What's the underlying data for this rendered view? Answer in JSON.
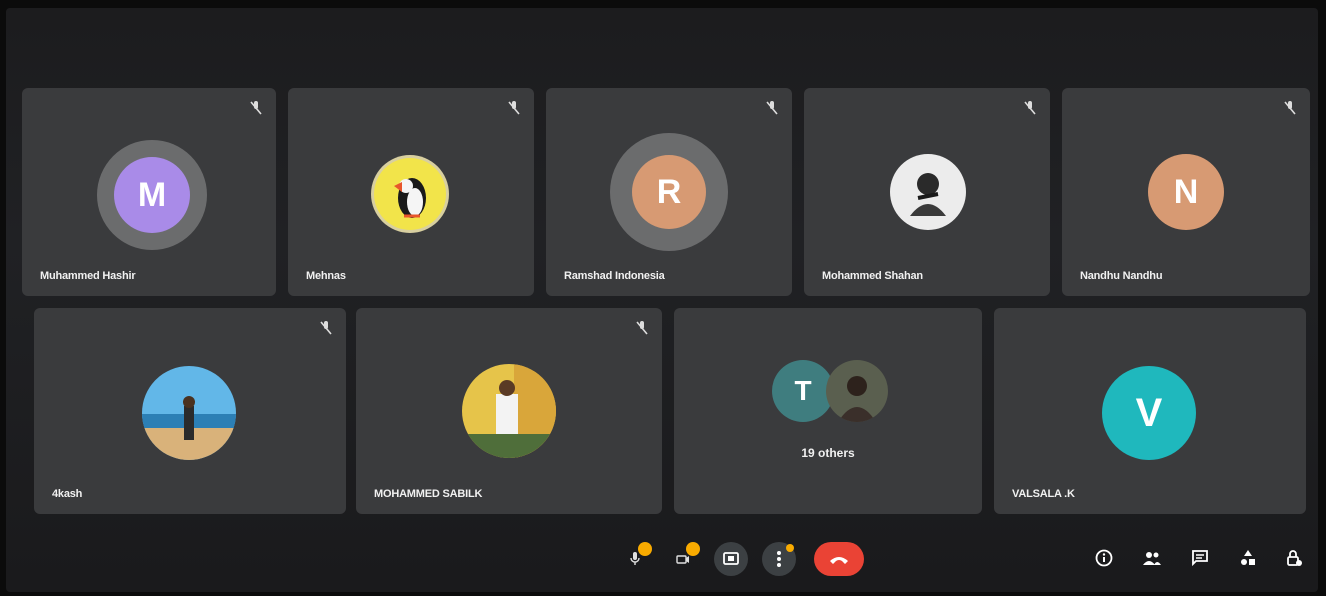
{
  "participants": [
    {
      "name": "Muhammed Hashir",
      "initial": "M",
      "color": "#a98be8"
    },
    {
      "name": "Mehnas",
      "picture": "puffin avatar"
    },
    {
      "name": "Ramshad Indonesia",
      "initial": "R",
      "color": "#d79a73"
    },
    {
      "name": "Mohammed Shahan",
      "picture": "photo avatar"
    },
    {
      "name": "Nandhu Nandhu",
      "initial": "N",
      "color": "#d79a73"
    },
    {
      "name": "4kash",
      "picture": "beach photo avatar"
    },
    {
      "name": "MOHAMMED SABILK",
      "picture": "photo avatar"
    },
    {
      "name": "19 others",
      "initial": "T",
      "color": "#3f7d7f"
    },
    {
      "name": "VALSALA .K",
      "initial": "V",
      "color": "#1fb8bd"
    }
  ],
  "toolbar": {
    "mic_icon": "microphone-off-icon",
    "camera_icon": "camera-off-icon",
    "present_icon": "present-screen-icon",
    "more_icon": "more-options-icon",
    "leave_icon": "hang-up-icon"
  },
  "right_icons": [
    "info-icon",
    "people-icon",
    "chat-icon",
    "activities-icon",
    "host-controls-icon"
  ],
  "colors": {
    "tile": "#3a3b3d",
    "hangup": "#ea4335",
    "badge": "#f9ab00"
  }
}
